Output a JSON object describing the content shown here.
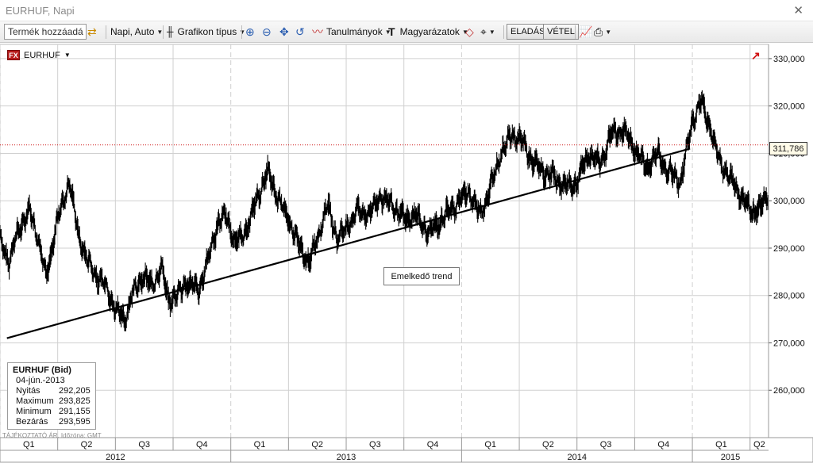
{
  "window": {
    "title": "EURHUF, Napi"
  },
  "toolbar": {
    "product_input": "Termék hozzáadá",
    "interval": "Napi, Auto",
    "chart_type": "Grafikon típus",
    "studies": "Tanulmányok",
    "annotations": "Magyarázatok",
    "sell": "ELADÁS",
    "buy": "VÉTEL"
  },
  "symbol": {
    "badge": "FX",
    "name": "EURHUF"
  },
  "price_tag": "311,786",
  "trend_label": "Emelkedő trend",
  "info_box": {
    "title": "EURHUF (Bid)",
    "date": "04-jún.-2013",
    "rows": [
      {
        "k": "Nyitás",
        "v": "292,205"
      },
      {
        "k": "Maximum",
        "v": "293,825"
      },
      {
        "k": "Minimum",
        "v": "291,155"
      },
      {
        "k": "Bezárás",
        "v": "293,595"
      }
    ]
  },
  "footnote": "TÁJÉKOZTATÓ ÁR.   Időzóna: GMT",
  "colors": {
    "price_line": "#000000",
    "current_price_line": "#d02020",
    "grid": "#d0d0d0",
    "trend": "#000000"
  },
  "chart_data": {
    "type": "line",
    "ylim": [
      250000,
      333000
    ],
    "y_ticks": [
      260000,
      270000,
      280000,
      290000,
      300000,
      310000,
      320000,
      330000
    ],
    "y_tick_labels": [
      "260,000",
      "270,000",
      "280,000",
      "290,000",
      "300,000",
      "310,000",
      "320,000",
      "330,000"
    ],
    "x_range": [
      2012.0,
      2015.33
    ],
    "quarters": [
      {
        "label": "Q1",
        "x": 2012.0
      },
      {
        "label": "Q2",
        "x": 2012.25
      },
      {
        "label": "Q3",
        "x": 2012.5
      },
      {
        "label": "Q4",
        "x": 2012.75
      },
      {
        "label": "Q1",
        "x": 2013.0
      },
      {
        "label": "Q2",
        "x": 2013.25
      },
      {
        "label": "Q3",
        "x": 2013.5
      },
      {
        "label": "Q4",
        "x": 2013.75
      },
      {
        "label": "Q1",
        "x": 2014.0
      },
      {
        "label": "Q2",
        "x": 2014.25
      },
      {
        "label": "Q3",
        "x": 2014.5
      },
      {
        "label": "Q4",
        "x": 2014.75
      },
      {
        "label": "Q1",
        "x": 2015.0
      },
      {
        "label": "Q2",
        "x": 2015.25
      }
    ],
    "years": [
      {
        "label": "2012",
        "x": 2012.0
      },
      {
        "label": "2013",
        "x": 2013.0
      },
      {
        "label": "2014",
        "x": 2014.0
      },
      {
        "label": "2015",
        "x": 2015.0
      }
    ],
    "series": [
      {
        "values": [
          [
            2012.0,
            292000
          ],
          [
            2012.04,
            287000
          ],
          [
            2012.08,
            294000
          ],
          [
            2012.13,
            298000
          ],
          [
            2012.17,
            291000
          ],
          [
            2012.2,
            284000
          ],
          [
            2012.25,
            296000
          ],
          [
            2012.3,
            304000
          ],
          [
            2012.34,
            293000
          ],
          [
            2012.38,
            287000
          ],
          [
            2012.42,
            284000
          ],
          [
            2012.46,
            282000
          ],
          [
            2012.5,
            277000
          ],
          [
            2012.54,
            275000
          ],
          [
            2012.58,
            281000
          ],
          [
            2012.62,
            284000
          ],
          [
            2012.66,
            282000
          ],
          [
            2012.7,
            286000
          ],
          [
            2012.73,
            279000
          ],
          [
            2012.77,
            280000
          ],
          [
            2012.81,
            283000
          ],
          [
            2012.86,
            281000
          ],
          [
            2012.9,
            287000
          ],
          [
            2012.94,
            295000
          ],
          [
            2012.98,
            297000
          ],
          [
            2013.02,
            291000
          ],
          [
            2013.07,
            294000
          ],
          [
            2013.11,
            300000
          ],
          [
            2013.16,
            306000
          ],
          [
            2013.2,
            301000
          ],
          [
            2013.25,
            296000
          ],
          [
            2013.3,
            290000
          ],
          [
            2013.34,
            287000
          ],
          [
            2013.38,
            293000
          ],
          [
            2013.42,
            299000
          ],
          [
            2013.46,
            292000
          ],
          [
            2013.5,
            294000
          ],
          [
            2013.55,
            298000
          ],
          [
            2013.6,
            297000
          ],
          [
            2013.65,
            301000
          ],
          [
            2013.7,
            299000
          ],
          [
            2013.75,
            296000
          ],
          [
            2013.8,
            297000
          ],
          [
            2013.86,
            293000
          ],
          [
            2013.91,
            296000
          ],
          [
            2013.97,
            299000
          ],
          [
            2014.03,
            302000
          ],
          [
            2014.08,
            297000
          ],
          [
            2014.12,
            302000
          ],
          [
            2014.17,
            310000
          ],
          [
            2014.22,
            314000
          ],
          [
            2014.27,
            312000
          ],
          [
            2014.31,
            308000
          ],
          [
            2014.36,
            306000
          ],
          [
            2014.4,
            305000
          ],
          [
            2014.45,
            303000
          ],
          [
            2014.5,
            304000
          ],
          [
            2014.55,
            310000
          ],
          [
            2014.6,
            308000
          ],
          [
            2014.65,
            314000
          ],
          [
            2014.7,
            315000
          ],
          [
            2014.75,
            311000
          ],
          [
            2014.8,
            307000
          ],
          [
            2014.85,
            310000
          ],
          [
            2014.9,
            306000
          ],
          [
            2014.95,
            304000
          ],
          [
            2015.0,
            317000
          ],
          [
            2015.04,
            321000
          ],
          [
            2015.08,
            315000
          ],
          [
            2015.12,
            308000
          ],
          [
            2015.16,
            305000
          ],
          [
            2015.2,
            302000
          ],
          [
            2015.25,
            298000
          ],
          [
            2015.29,
            298000
          ],
          [
            2015.33,
            302000
          ]
        ]
      }
    ],
    "trendline": {
      "from": [
        2012.03,
        271000
      ],
      "to": [
        2014.99,
        311000
      ],
      "label": "Emelkedő trend"
    },
    "current_price": 311786
  }
}
